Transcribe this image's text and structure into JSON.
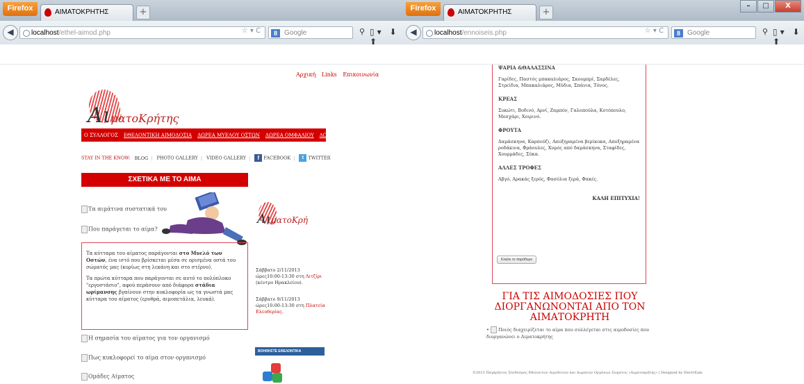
{
  "browser": {
    "app_button": "Firefox",
    "tab_title": "ΑΙΜΑΤΟΚΡΗΤΗΣ",
    "new_tab": "+",
    "window_controls": {
      "minimize": "–",
      "restore": "□",
      "close": "X"
    },
    "search_engine_label": "Google",
    "nav_icons": "▯▾ ⬇ ⬆"
  },
  "left_window": {
    "url_host": "localhost",
    "url_path": "/ethel-aimod.php",
    "top_links": [
      "Αρχική",
      "Links",
      "Επικοινωνία"
    ],
    "logo_main": "Αι",
    "logo_sub": "ματοΚρήτης",
    "main_nav": [
      "Ο ΣΥΛΛΟΓΟΣ",
      "ΕΘΕΛΟΝΤΙΚΗ ΑΙΜΟΔΟΣΙΑ",
      "ΔΩΡΕΑ ΜΥΕΛΟΥ ΟΣΤΩΝ",
      "ΔΩΡΕΑ ΟΜΦΑΛΙΟΥ",
      "ΔΩΡΕΑ ΟΡΓΑΝΩΝ"
    ],
    "social": {
      "label": "STAY IN THE KNOW:",
      "items": [
        "BLOG",
        "PHOTO GALLERY",
        "VIDEO GALLERY",
        "FACEBOOK",
        "TWITTER"
      ]
    },
    "section_title": "ΣΧΕΤΙΚΑ ΜΕ ΤΟ ΑΙΜΑ",
    "accordion": [
      "Τα αιμάτινα συστατικά του",
      "Που παράγεται το αίμα?",
      "Η σημασία του αίματος για τον οργανισμό",
      "Πως κυκλοφορεί το αίμα στον οργανισμό",
      "Ομάδες Αίματος"
    ],
    "info": {
      "p1_a": "Τα κύτταρα του αίματος παράγονται ",
      "p1_b": "στο Μυελό των Οστών",
      "p1_c": ", ένα ιστό που βρίσκεται μέσα σε ορισμένα οστά του σώματός μας (κυρίως στη λεκάνη και στο στέρνο).",
      "p2_a": "Τα πρώτα κύτταρα που παράγονται σε αυτό το πολύπλοκο \"εργοστάσιο\", αφού περάσουν από διάφορα ",
      "p2_b": "στάδια ωρίμανσης",
      "p2_c": " βγαίνουν στην κυκλοφορία ως τα γνωστά μας κύτταρα του αίματος (ερυθρά, αιμοπετάλια, λευκά)."
    },
    "sidebar": {
      "logo_main": "Αι",
      "logo_sub": "ματοΚρή",
      "event1_a": "Σάββατο 2/11/2013 ώρες10:00-13:30 στη ",
      "event1_place": "Λιτζίρι",
      "event1_c": " (κέντρο Ηρακλείου).",
      "event2_a": "Σάββατο 9/11/2013 ώρες10:00-13:30 στη ",
      "event2_place": "Πλατεία Ελευθερίας",
      "event2_c": ".",
      "volunteer_bar": "ΒΟΗΘΗΣΤΕ ΕΘΕΛΟΝΤΙΚΑ"
    }
  },
  "right_window": {
    "url_host": "localhost",
    "url_path": "/ennoiseis.php",
    "sections": [
      {
        "title": "ΨΑΡΙΑ &ΘΑΛΑΣΣΙΝΑ",
        "text": "Γαρίδες, Παστός μπακαλιάρος, Σκουμπρί, Σαρδέλες, Στρείδια, Μπακαλιάρος, Μύδια, Σπάνια, Τόνος."
      },
      {
        "title": "ΚΡΕΑΣ",
        "text": "Συκώτι, Βοδινό, Αρνί, Ζαμπόν, Γαλοπούλα, Κοτόπουλο, Μοσχάρι, Χοιρινό."
      },
      {
        "title": "ΦΡΟΥΤΑ",
        "text": "Δαμάσκηνα, Καρπούζι, Αποξηραμένα βερίκοκα, Αποξηραμένα ροδάκινα, Φράουλες, Χυμός από δαμάσκηνα, Σταφίδες, Χουρμάδες, Σύκα."
      },
      {
        "title": "ΑΛΛΕΣ ΤΡΟΦΕΣ",
        "text": "Αβγό, Αρακάς ξερός, Φασόλια ξερά, Φακές."
      }
    ],
    "good_luck": "ΚΑΛΗ ΕΠΙΤΥΧΙΑ!",
    "close_button": "Κλείσε το παράθυρο",
    "heading": "ΓΙΑ ΤΙΣ ΑΙΜΟΔΟΣΙΕΣ ΠΟΥ ΔΙΟΡΓΑΝΩΝΟΝΤΑΙ ΑΠΟ ΤΟΝ ΑΙΜΑΤΟΚΡΗΤΗ",
    "question": "Ποιός διαχειρίζεται το αίμα που συλλέγεται στις αιμοδοσίες που διοργανώνει ο Αιματοκρήτης",
    "footer": "©2013 Παγκρήτιος Σύνδεσμος Εθελοντών Αιμοδοτών και Δωρητών Οργάνων Σώματος «Αιματοκρήτης»   |   Designed by ElectrEam"
  },
  "colors": {
    "brand_red": "#d40000",
    "link_red": "#c00000",
    "volunteer_blue": "#2d5f9a"
  }
}
